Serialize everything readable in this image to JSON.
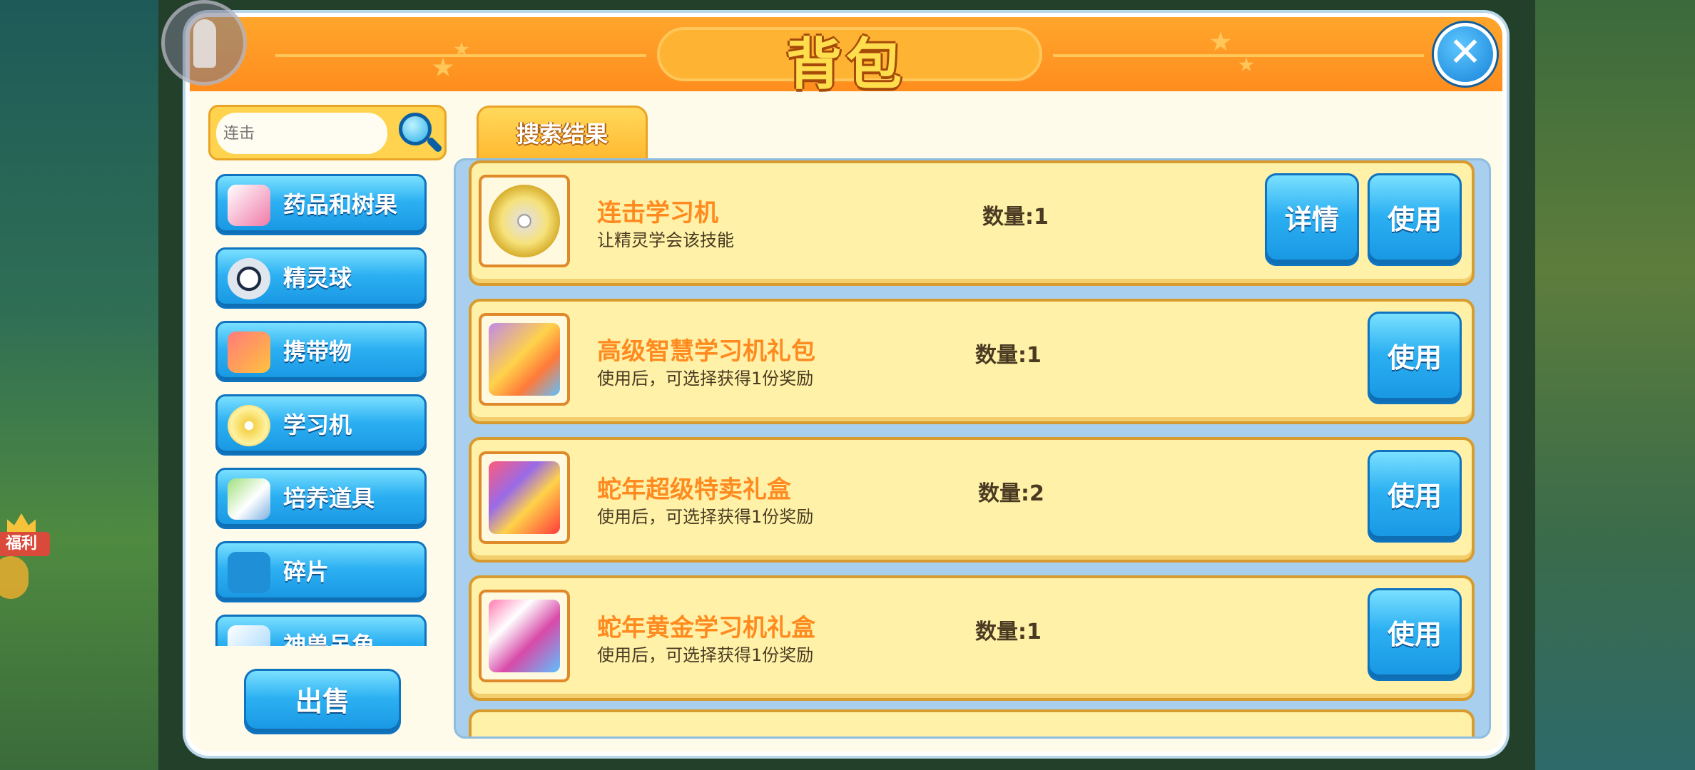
{
  "panel": {
    "title": "背包"
  },
  "welfare": {
    "label": "福利"
  },
  "search": {
    "placeholder": "连击"
  },
  "tab": {
    "label": "搜索结果"
  },
  "categories": [
    {
      "label": "药品和树果",
      "icon": "potion-icon"
    },
    {
      "label": "精灵球",
      "icon": "pokeball-icon"
    },
    {
      "label": "携带物",
      "icon": "held-item-icon"
    },
    {
      "label": "学习机",
      "icon": "disc-icon"
    },
    {
      "label": "培养道具",
      "icon": "training-item-icon"
    },
    {
      "label": "碎片",
      "icon": "puzzle-piece-icon"
    },
    {
      "label": "神兽吊角",
      "icon": "legendary-icon"
    }
  ],
  "sell_label": "出售",
  "items": [
    {
      "name": "连击学习机",
      "desc": "让精灵学会该技能",
      "qty": "数量:1",
      "detail_label": "详情",
      "use_label": "使用",
      "icon": "disc-icon"
    },
    {
      "name": "高级智慧学习机礼包",
      "desc": "使用后，可选择获得1份奖励",
      "qty": "数量:1",
      "use_label": "使用",
      "icon": "gift-box-icon"
    },
    {
      "name": "蛇年超级特卖礼盒",
      "desc": "使用后，可选择获得1份奖励",
      "qty": "数量:2",
      "use_label": "使用",
      "icon": "gift-box-2025-icon"
    },
    {
      "name": "蛇年黄金学习机礼盒",
      "desc": "使用后，可选择获得1份奖励",
      "qty": "数量:1",
      "use_label": "使用",
      "icon": "gift-box-2025-icon"
    }
  ],
  "colors": {
    "header_orange": "#ff8d1e",
    "button_blue": "#2cb0f2",
    "item_name_orange": "#ff8a1f",
    "item_bg": "#fff2a8"
  }
}
